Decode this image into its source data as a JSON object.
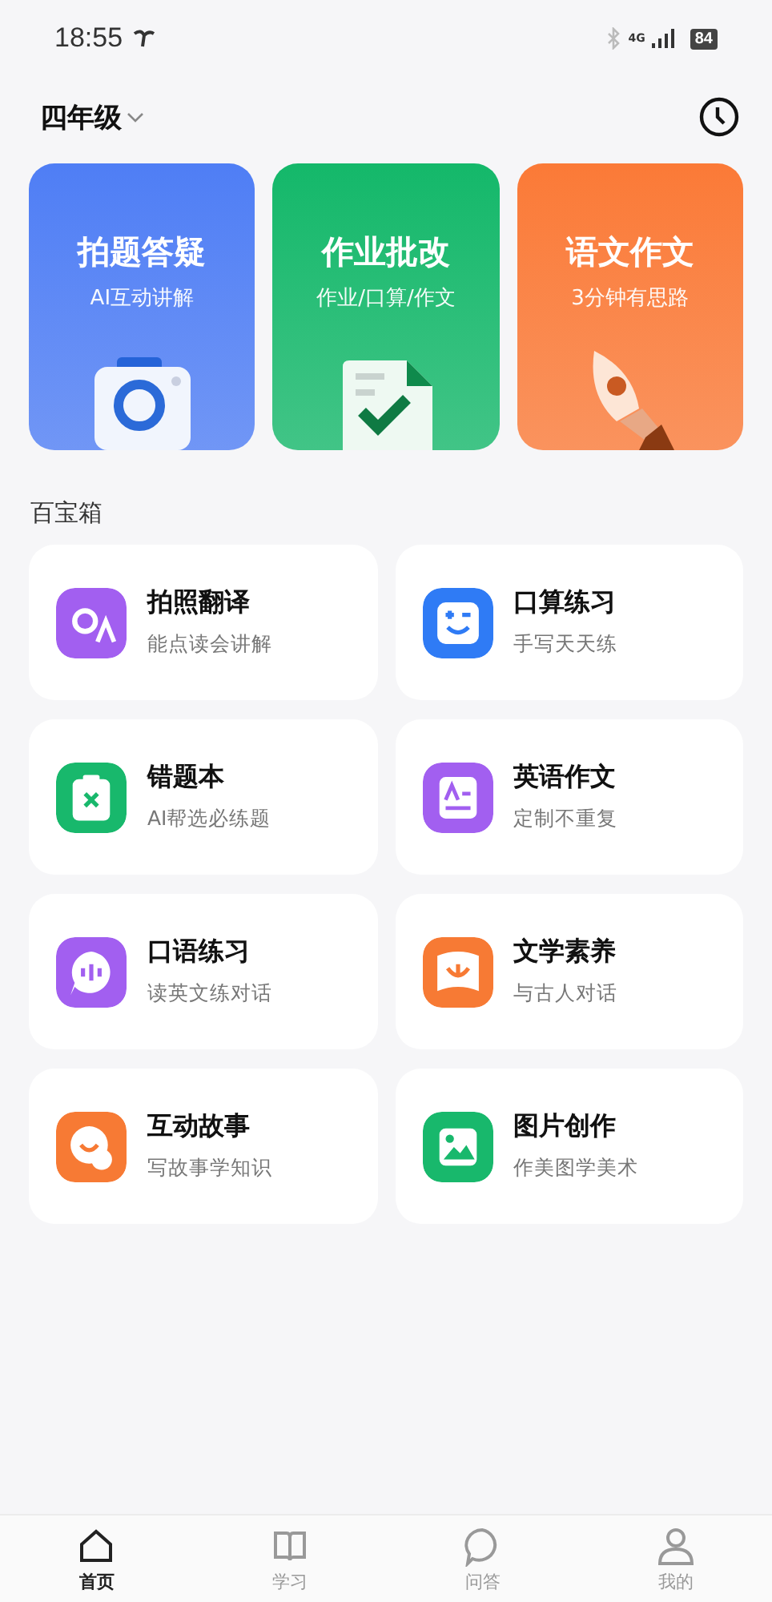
{
  "status_bar": {
    "time": "18:55",
    "battery": "84",
    "network": "4G"
  },
  "header": {
    "grade": "四年级"
  },
  "features": [
    {
      "title": "拍题答疑",
      "subtitle": "AI互动讲解",
      "color": "#4f7ef5"
    },
    {
      "title": "作业批改",
      "subtitle": "作业/口算/作文",
      "color": "#14b86a"
    },
    {
      "title": "语文作文",
      "subtitle": "3分钟有思路",
      "color": "#fb7a37"
    }
  ],
  "toolbox": {
    "title": "百宝箱",
    "items": [
      {
        "title": "拍照翻译",
        "subtitle": "能点读会讲解",
        "color": "#a25ff0"
      },
      {
        "title": "口算练习",
        "subtitle": "手写天天练",
        "color": "#2f7bf5"
      },
      {
        "title": "错题本",
        "subtitle": "AI帮选必练题",
        "color": "#18b86c"
      },
      {
        "title": "英语作文",
        "subtitle": "定制不重复",
        "color": "#a25ff0"
      },
      {
        "title": "口语练习",
        "subtitle": "读英文练对话",
        "color": "#a25ff0"
      },
      {
        "title": "文学素养",
        "subtitle": "与古人对话",
        "color": "#f77a34"
      },
      {
        "title": "互动故事",
        "subtitle": "写故事学知识",
        "color": "#f77a34"
      },
      {
        "title": "图片创作",
        "subtitle": "作美图学美术",
        "color": "#18b86c"
      }
    ]
  },
  "tab_bar": [
    {
      "label": "首页",
      "selected": true
    },
    {
      "label": "学习",
      "selected": false
    },
    {
      "label": "问答",
      "selected": false
    },
    {
      "label": "我的",
      "selected": false
    }
  ]
}
